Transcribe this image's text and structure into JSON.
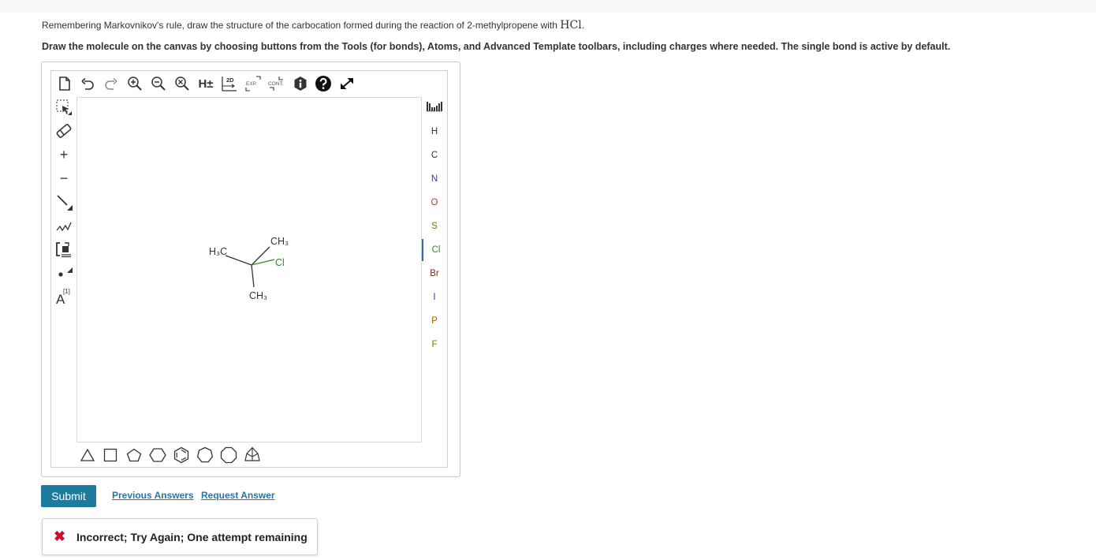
{
  "question": {
    "text": "Remembering Markovnikov's rule, draw the structure of the carbocation formed during the reaction of 2-methylpropene with",
    "formula": "HCl",
    "end": "."
  },
  "instructions": "Draw the molecule on the canvas by choosing buttons from the Tools (for bonds), Atoms, and Advanced Template toolbars, including charges where needed. The single bond is active by default.",
  "top_toolbar": {
    "h_label": "H±",
    "two_d_label": "2D",
    "exp_label": "EXP.",
    "cont_label": "CONT."
  },
  "left_toolbar": {
    "charge_plus": "+",
    "charge_minus": "−",
    "atom_map_label": "A",
    "atom_map_sup": "[1]"
  },
  "atoms": [
    {
      "label": "H",
      "color": "#333333"
    },
    {
      "label": "C",
      "color": "#333333"
    },
    {
      "label": "N",
      "color": "#2b3fa0"
    },
    {
      "label": "O",
      "color": "#c0392b"
    },
    {
      "label": "S",
      "color": "#8a6d00"
    },
    {
      "label": "Cl",
      "color": "#2e8b2e"
    },
    {
      "label": "Br",
      "color": "#7a2d10"
    },
    {
      "label": "I",
      "color": "#6a1b9a"
    },
    {
      "label": "P",
      "color": "#b35c00"
    },
    {
      "label": "F",
      "color": "#8a6d00"
    }
  ],
  "molecule": {
    "left_group": "H₃C",
    "top_group": "CH₃",
    "bottom_group": "CH₃",
    "halogen": "Cl"
  },
  "actions": {
    "submit": "Submit",
    "previous_answers": "Previous Answers",
    "request_answer": "Request Answer"
  },
  "feedback": {
    "icon": "✖",
    "message": "Incorrect; Try Again; One attempt remaining"
  },
  "colors": {
    "submit_bg": "#1f7b9e",
    "link": "#2a73a3",
    "error": "#c8102e",
    "chlorine": "#2e8b2e"
  }
}
